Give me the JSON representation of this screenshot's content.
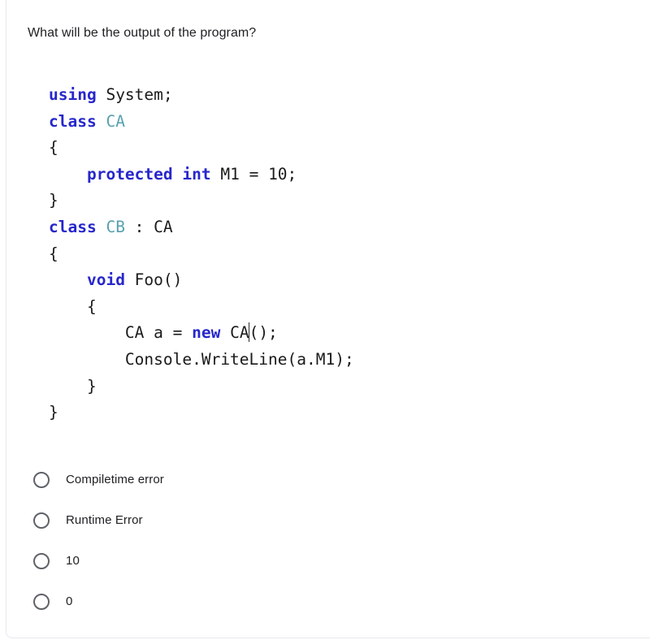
{
  "question": {
    "text": "What will be the output of the program?"
  },
  "code": {
    "language": "csharp",
    "colors": {
      "keyword": "#2727cc",
      "type": "#57a0ae",
      "plain": "#1a1a1a",
      "background": "#ffffff"
    },
    "caret_visible": true,
    "lines": [
      {
        "indent": 0,
        "tokens": [
          {
            "t": "using",
            "c": "kw"
          },
          {
            "t": " ",
            "c": "plain"
          },
          {
            "t": "System;",
            "c": "plain"
          }
        ]
      },
      {
        "indent": 0,
        "tokens": [
          {
            "t": "class",
            "c": "kw"
          },
          {
            "t": " ",
            "c": "plain"
          },
          {
            "t": "CA",
            "c": "type"
          }
        ]
      },
      {
        "indent": 0,
        "tokens": [
          {
            "t": "{",
            "c": "plain"
          }
        ]
      },
      {
        "indent": 4,
        "tokens": [
          {
            "t": "protected",
            "c": "kw"
          },
          {
            "t": " ",
            "c": "plain"
          },
          {
            "t": "int",
            "c": "kw"
          },
          {
            "t": " M1 = 10;",
            "c": "plain"
          }
        ]
      },
      {
        "indent": 0,
        "tokens": [
          {
            "t": "}",
            "c": "plain"
          }
        ]
      },
      {
        "indent": 0,
        "tokens": [
          {
            "t": "class",
            "c": "kw"
          },
          {
            "t": " ",
            "c": "plain"
          },
          {
            "t": "CB",
            "c": "type"
          },
          {
            "t": " : CA",
            "c": "plain"
          }
        ]
      },
      {
        "indent": 0,
        "tokens": [
          {
            "t": "{",
            "c": "plain"
          }
        ]
      },
      {
        "indent": 4,
        "tokens": [
          {
            "t": "void",
            "c": "kw"
          },
          {
            "t": " Foo()",
            "c": "plain"
          }
        ]
      },
      {
        "indent": 4,
        "tokens": [
          {
            "t": "{",
            "c": "plain"
          }
        ]
      },
      {
        "indent": 8,
        "tokens": [
          {
            "t": "CA a = ",
            "c": "plain"
          },
          {
            "t": "new",
            "c": "kw"
          },
          {
            "t": " CA",
            "c": "plain"
          },
          {
            "t": "",
            "c": "caret"
          },
          {
            "t": "();",
            "c": "plain"
          }
        ]
      },
      {
        "indent": 8,
        "tokens": [
          {
            "t": "Console.WriteLine(a.M1);",
            "c": "plain"
          }
        ]
      },
      {
        "indent": 4,
        "tokens": [
          {
            "t": "}",
            "c": "plain"
          }
        ]
      },
      {
        "indent": 0,
        "tokens": [
          {
            "t": "}",
            "c": "plain"
          }
        ]
      }
    ]
  },
  "answer_options": [
    {
      "label": "Compiletime error",
      "selected": false
    },
    {
      "label": "Runtime Error",
      "selected": false
    },
    {
      "label": "10",
      "selected": false
    },
    {
      "label": "0",
      "selected": false
    }
  ]
}
